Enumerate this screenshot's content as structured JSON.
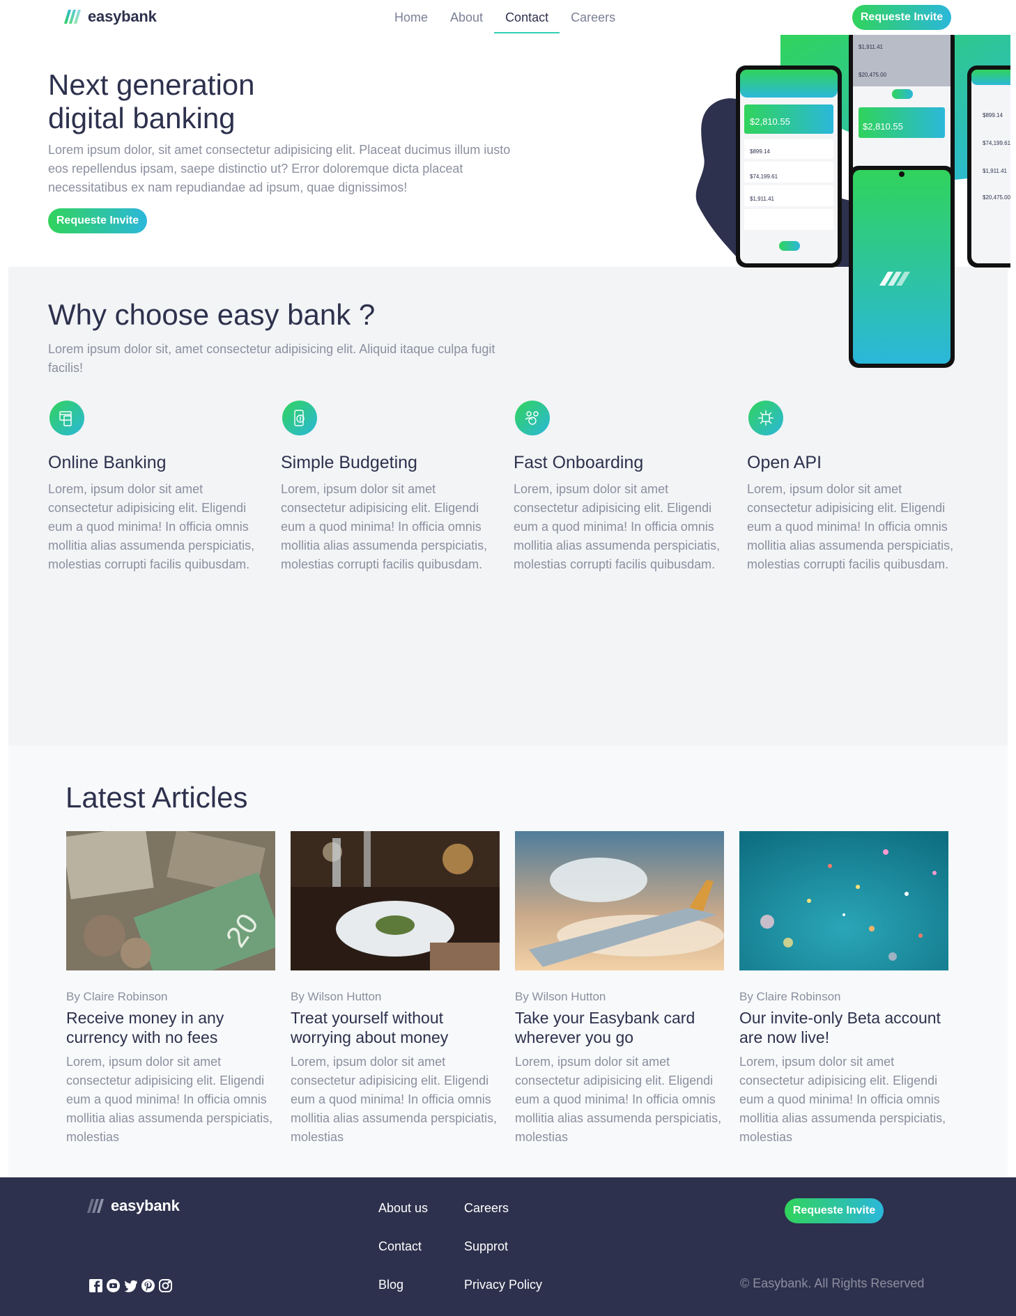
{
  "brand": {
    "name": "easybank"
  },
  "nav": {
    "links": [
      "Home",
      "About",
      "Contact",
      "Careers"
    ],
    "active": "Contact",
    "cta": "Requeste Invite"
  },
  "hero": {
    "title_line1": "Next generation",
    "title_line2": "digital banking",
    "description": "Lorem ipsum dolor, sit amet consectetur adipisicing elit. Placeat ducimus illum iusto eos repellendus ipsam, saepe distinctio ut? Error doloremque dicta placeat necessitatibus ex nam repudiandae ad ipsum, quae dignissimos!",
    "cta": "Requeste Invite",
    "phones": {
      "balance": "$2,810.55",
      "amounts": [
        "$1,911.41",
        "$20,475.00",
        "$899.14",
        "$74,199.61",
        "$1,911.41",
        "$20,475.00"
      ]
    }
  },
  "why": {
    "title": "Why choose easy bank ?",
    "description": "Lorem ipsum dolor sit, amet consectetur adipisicing elit. Aliquid itaque culpa fugit facilis!",
    "features": [
      {
        "icon": "online-banking-icon",
        "title": "Online Banking",
        "text": "Lorem, ipsum dolor sit amet consectetur adipisicing elit. Eligendi eum a quod minima! In officia omnis mollitia alias assumenda perspiciatis, molestias corrupti facilis quibusdam."
      },
      {
        "icon": "budgeting-icon",
        "title": "Simple Budgeting",
        "text": "Lorem, ipsum dolor sit amet consectetur adipisicing elit. Eligendi eum a quod minima! In officia omnis mollitia alias assumenda perspiciatis, molestias corrupti facilis quibusdam."
      },
      {
        "icon": "onboarding-icon",
        "title": "Fast Onboarding",
        "text": "Lorem, ipsum dolor sit amet consectetur adipisicing elit. Eligendi eum a quod minima! In officia omnis mollitia alias assumenda perspiciatis, molestias corrupti facilis quibusdam."
      },
      {
        "icon": "api-icon",
        "title": "Open API",
        "text": "Lorem, ipsum dolor sit amet consectetur adipisicing elit. Eligendi eum a quod minima! In officia omnis mollitia alias assumenda perspiciatis, molestias corrupti facilis quibusdam."
      }
    ]
  },
  "articles": {
    "title": "Latest Articles",
    "items": [
      {
        "author": "By Claire Robinson",
        "title": "Receive money in any currency with no fees",
        "text": "Lorem, ipsum dolor sit amet consectetur adipisicing elit. Eligendi eum a quod minima! In officia omnis mollitia alias assumenda perspiciatis, molestias",
        "image": "currency-image"
      },
      {
        "author": "By Wilson Hutton",
        "title": "Treat yourself without worrying about money",
        "text": "Lorem, ipsum dolor sit amet consectetur adipisicing elit. Eligendi eum a quod minima! In officia omnis mollitia alias assumenda perspiciatis, molestias",
        "image": "restaurant-image"
      },
      {
        "author": "By Wilson Hutton",
        "title": "Take your Easybank card wherever you go",
        "text": "Lorem, ipsum dolor sit amet consectetur adipisicing elit. Eligendi eum a quod minima! In officia omnis mollitia alias assumenda perspiciatis, molestias",
        "image": "plane-image"
      },
      {
        "author": "By Claire Robinson",
        "title": "Our invite-only Beta account are now live!",
        "text": "Lorem, ipsum dolor sit amet consectetur adipisicing elit. Eligendi eum a quod minima! In officia omnis mollitia alias assumenda perspiciatis, molestias",
        "image": "confetti-image"
      }
    ]
  },
  "footer": {
    "links": [
      "About us",
      "Careers",
      "Contact",
      "Supprot",
      "Blog",
      "Privacy Policy"
    ],
    "cta": "Requeste Invite",
    "copyright": "© Easybank. All Rights Reserved",
    "socials": [
      "facebook-icon",
      "youtube-icon",
      "twitter-icon",
      "pinterest-icon",
      "instagram-icon"
    ]
  },
  "colors": {
    "navy": "#2d314d",
    "lime": "#31d35c",
    "cyan": "#2bb7da",
    "gray_text": "#8b8f9f",
    "light_bg": "#f3f4f6"
  }
}
